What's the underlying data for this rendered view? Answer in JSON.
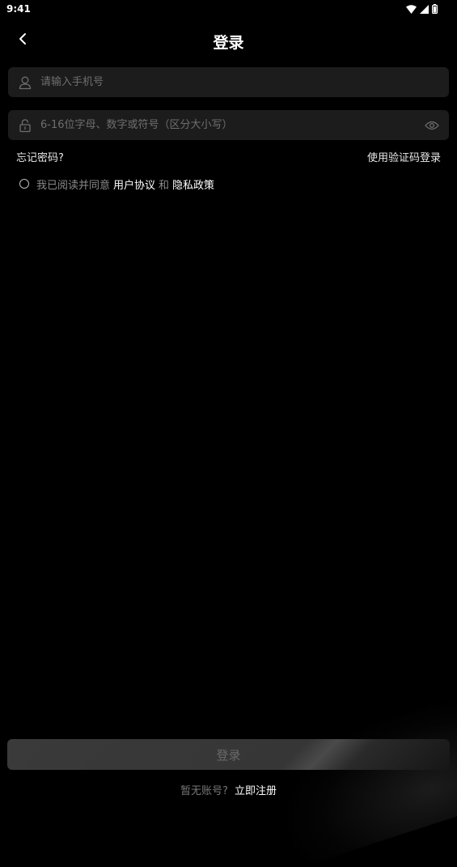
{
  "status_bar": {
    "time": "9:41",
    "icons": [
      "wifi-icon",
      "signal-icon",
      "battery-icon"
    ]
  },
  "header": {
    "title": "登录",
    "back_icon": "chevron-left-icon"
  },
  "form": {
    "phone": {
      "icon": "user-icon",
      "value": "",
      "placeholder": "请输入手机号"
    },
    "password": {
      "icon": "lock-icon",
      "value": "",
      "placeholder": "6-16位字母、数字或符号（区分大小写）",
      "toggle_icon": "eye-icon"
    },
    "forgot_password": "忘记密码?",
    "sms_login": "使用验证码登录"
  },
  "agreement": {
    "prefix": "我已阅读并同意",
    "user_agreement": "用户协议",
    "and": "和",
    "privacy_policy": "隐私政策",
    "checked": false
  },
  "footer": {
    "login_button": "登录",
    "no_account": "暂无账号?",
    "register_link": "立即注册"
  },
  "colors": {
    "background": "#000000",
    "field_background": "#1c1c1c",
    "button_disabled": "#3a3a3a"
  }
}
